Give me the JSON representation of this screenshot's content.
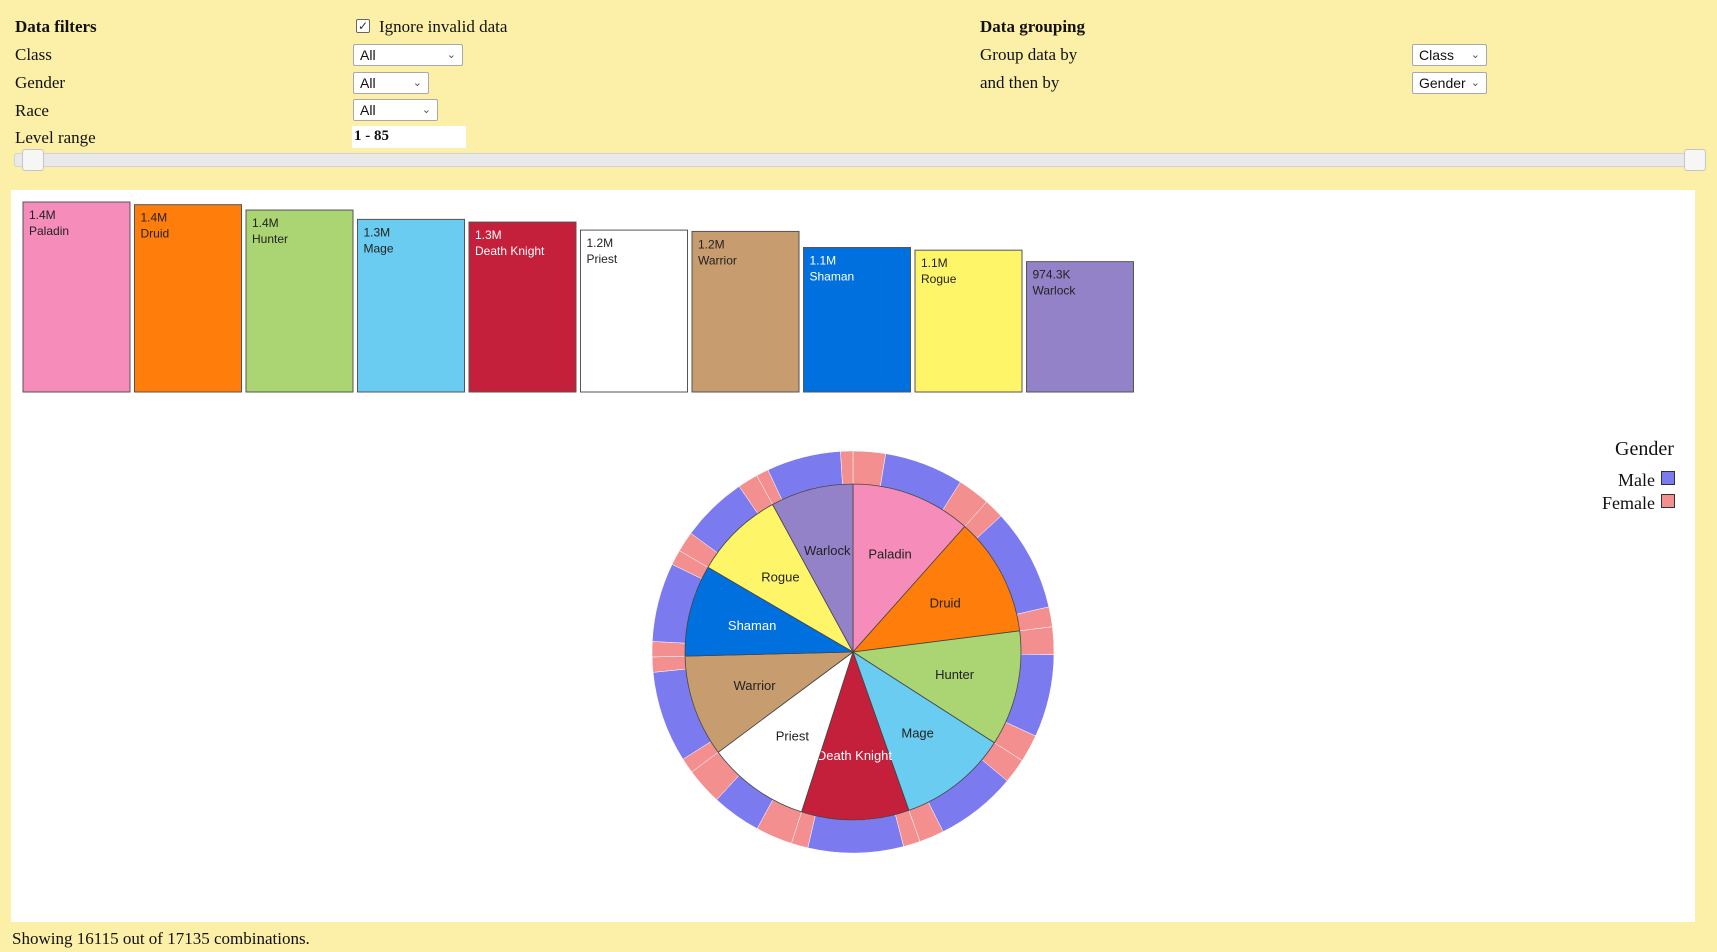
{
  "filters": {
    "title": "Data filters",
    "ignore_invalid_label": "Ignore invalid data",
    "ignore_invalid_checked": true,
    "class_label": "Class",
    "class_value": "All",
    "gender_label": "Gender",
    "gender_value": "All",
    "race_label": "Race",
    "race_value": "All",
    "level_label": "Level range",
    "level_value": "1 - 85",
    "level_min": 1,
    "level_max": 85
  },
  "grouping": {
    "title": "Data grouping",
    "group_by_label": "Group data by",
    "group_by_value": "Class",
    "then_by_label": "and then by",
    "then_by_value": "Gender"
  },
  "colors": {
    "background": "#fcefa8",
    "male": "#7b7bef",
    "female": "#f38f8f"
  },
  "chart_data": [
    {
      "type": "bar",
      "categories": [
        "Paladin",
        "Druid",
        "Hunter",
        "Mage",
        "Death Knight",
        "Priest",
        "Warrior",
        "Shaman",
        "Rogue",
        "Warlock"
      ],
      "value_labels": [
        "1.4M",
        "1.4M",
        "1.4M",
        "1.3M",
        "1.3M",
        "1.2M",
        "1.2M",
        "1.1M",
        "1.1M",
        "974.3K"
      ],
      "values": [
        1420000,
        1400000,
        1360000,
        1290000,
        1270000,
        1210000,
        1200000,
        1080000,
        1060000,
        974300
      ],
      "colors": [
        "#f58cba",
        "#ff7d0a",
        "#abd473",
        "#69ccf0",
        "#c41f3b",
        "#ffffff",
        "#c79c6e",
        "#0070de",
        "#fff569",
        "#9482c9"
      ]
    },
    {
      "type": "pie",
      "title": "",
      "inner": {
        "labels": [
          "Paladin",
          "Druid",
          "Hunter",
          "Mage",
          "Death Knight",
          "Priest",
          "Warrior",
          "Shaman",
          "Rogue",
          "Warlock"
        ],
        "values": [
          1420000,
          1400000,
          1360000,
          1290000,
          1270000,
          1210000,
          1200000,
          1080000,
          1060000,
          974300
        ],
        "colors": [
          "#f58cba",
          "#ff7d0a",
          "#abd473",
          "#69ccf0",
          "#c41f3b",
          "#ffffff",
          "#c79c6e",
          "#0070de",
          "#fff569",
          "#9482c9"
        ]
      },
      "outer": {
        "series": [
          "Male",
          "Female"
        ],
        "male_share": [
          0.55,
          0.72,
          0.6,
          0.62,
          0.74,
          0.4,
          0.75,
          0.72,
          0.62,
          0.75
        ]
      },
      "legend": {
        "title": "Gender",
        "entries": [
          "Male",
          "Female"
        ],
        "placement": "top-right"
      }
    }
  ],
  "status": {
    "text": "Showing 16115 out of 17135 combinations."
  }
}
